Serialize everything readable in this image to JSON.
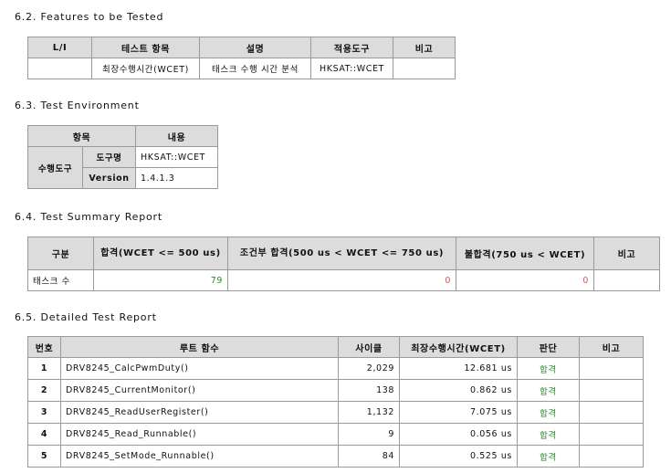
{
  "sec62": {
    "heading": "6.2. Features to be Tested",
    "headers": [
      "L/I",
      "테스트 항목",
      "설명",
      "적용도구",
      "비고"
    ],
    "row": [
      "",
      "최장수행시간(WCET)",
      "태스크 수행 시간 분석",
      "HKSAT::WCET",
      ""
    ]
  },
  "sec63": {
    "heading": "6.3. Test Environment",
    "headers": [
      "항목",
      "내용"
    ],
    "group_label": "수행도구",
    "rows": [
      {
        "key": "도구명",
        "value": "HKSAT::WCET"
      },
      {
        "key": "Version",
        "value": "1.4.1.3"
      }
    ]
  },
  "sec64": {
    "heading": "6.4. Test Summary Report",
    "headers": [
      "구분",
      "합격(WCET <= 500 us)",
      "조건부 합격(500 us < WCET <= 750 us)",
      "불합격(750 us < WCET)",
      "비고"
    ],
    "row": {
      "label": "태스크 수",
      "pass": "79",
      "conditional": "0",
      "fail": "0",
      "note": ""
    }
  },
  "sec65": {
    "heading": "6.5. Detailed Test Report",
    "headers": [
      "번호",
      "루트 함수",
      "사이클",
      "최장수행시간(WCET)",
      "판단",
      "비고"
    ],
    "rows": [
      {
        "no": "1",
        "func": "DRV8245_CalcPwmDuty()",
        "cycle": "2,029",
        "wcet": "12.681 us",
        "result": "합격",
        "note": ""
      },
      {
        "no": "2",
        "func": "DRV8245_CurrentMonitor()",
        "cycle": "138",
        "wcet": "0.862 us",
        "result": "합격",
        "note": ""
      },
      {
        "no": "3",
        "func": "DRV8245_ReadUserRegister()",
        "cycle": "1,132",
        "wcet": "7.075 us",
        "result": "합격",
        "note": ""
      },
      {
        "no": "4",
        "func": "DRV8245_Read_Runnable()",
        "cycle": "9",
        "wcet": "0.056 us",
        "result": "합격",
        "note": ""
      },
      {
        "no": "5",
        "func": "DRV8245_SetMode_Runnable()",
        "cycle": "84",
        "wcet": "0.525 us",
        "result": "합격",
        "note": ""
      }
    ]
  }
}
